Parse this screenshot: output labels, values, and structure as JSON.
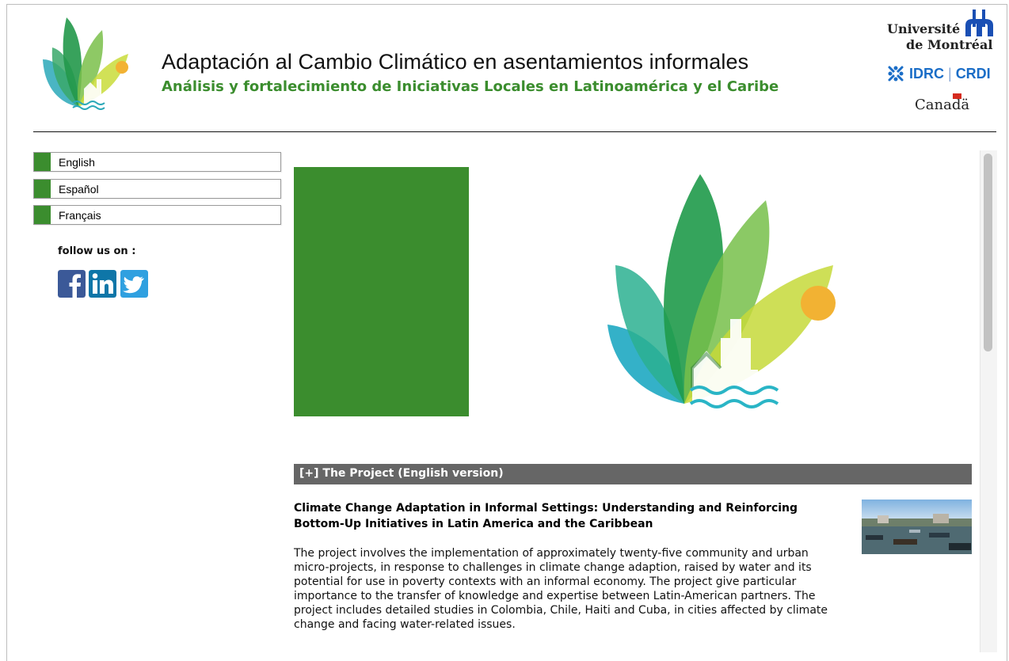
{
  "header": {
    "title": "Adaptación al Cambio Climático en asentamientos informales",
    "subtitle": "Análisis y fortalecimiento de Iniciativas Locales en Latinoamérica y el Caribe",
    "partners": {
      "udem_line1": "Université",
      "udem_line2": "de Montréal",
      "idrc": "IDRC",
      "crdi": "CRDI",
      "canada": "Canadä"
    }
  },
  "sidebar": {
    "languages": [
      "English",
      "Español",
      "Français"
    ],
    "follow_label": "follow us on :",
    "social": [
      {
        "name": "facebook",
        "glyph": "f",
        "color": "#3b5998"
      },
      {
        "name": "linkedin",
        "glyph": "in",
        "color": "#0e76a8"
      },
      {
        "name": "twitter",
        "glyph": "",
        "color": "#2fa0e0"
      }
    ]
  },
  "main": {
    "section_toggle": "[+] The Project (English version)",
    "project_title": "Climate Change Adaptation in Informal Settings: Understanding and Reinforcing Bottom-Up Initiatives in Latin America and the Caribbean",
    "project_body": "The project involves the implementation of approximately twenty-five community and urban micro-projects, in response to challenges in climate change adaption, raised by water and its potential for use in poverty contexts with an informal economy. The project give particular importance to the transfer of knowledge and expertise between Latin-American partners. The project includes detailed studies in Colombia, Chile, Haiti and Cuba, in cities affected by climate change and facing water-related issues."
  },
  "colors": {
    "brand_green": "#3b8d2e",
    "section_bar": "#666666",
    "idrc_blue": "#1a6dc7"
  }
}
